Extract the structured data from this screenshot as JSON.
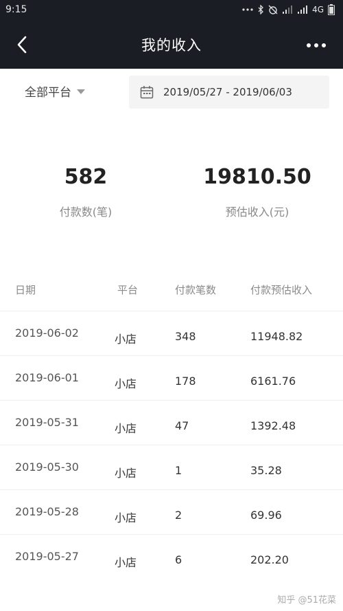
{
  "status_bar": {
    "time": "9:15",
    "network": "4G",
    "icons": [
      "dots-icon",
      "bluetooth-icon",
      "alarm-icon",
      "signal-icon",
      "signal-icon"
    ]
  },
  "nav": {
    "title": "我的收入",
    "back_icon": "chevron-left-icon",
    "more_icon": "more-dots-icon"
  },
  "filters": {
    "platform": "全部平台",
    "date_range": "2019/05/27 - 2019/06/03",
    "calendar_icon": "calendar-icon"
  },
  "summary": {
    "payments_count": "582",
    "payments_label": "付款数(笔)",
    "estimated_income": "19810.50",
    "estimated_label": "预估收入(元)"
  },
  "table": {
    "headers": [
      "日期",
      "平台",
      "付款笔数",
      "付款预估收入"
    ],
    "rows": [
      [
        "2019-06-02",
        "小店",
        "348",
        "11948.82"
      ],
      [
        "2019-06-01",
        "小店",
        "178",
        "6161.76"
      ],
      [
        "2019-05-31",
        "小店",
        "47",
        "1392.48"
      ],
      [
        "2019-05-30",
        "小店",
        "1",
        "35.28"
      ],
      [
        "2019-05-28",
        "小店",
        "2",
        "69.96"
      ],
      [
        "2019-05-27",
        "小店",
        "6",
        "202.20"
      ]
    ]
  },
  "watermark": "知乎 @51花菜",
  "colors": {
    "header_bg": "#1b1d24",
    "date_box_bg": "#f4f4f4"
  }
}
